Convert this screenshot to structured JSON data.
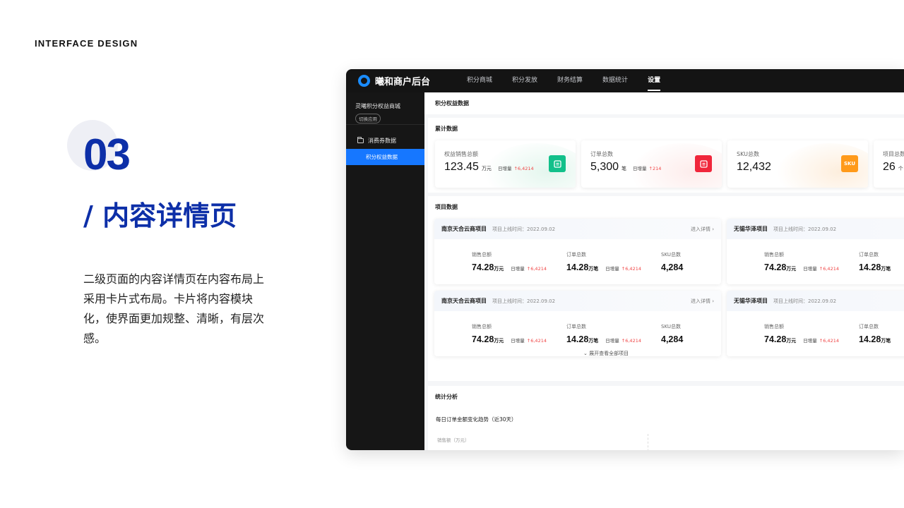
{
  "slide": {
    "brand_label": "INTERFACE DESIGN",
    "number": "03",
    "title": "/ 内容详情页",
    "description": "二级页面的内容详情页在内容布局上采用卡片式布局。卡片将内容模块化，使界面更加规整、清晰，有层次感。"
  },
  "app": {
    "logo_text": "曦和商户后台",
    "nav": [
      {
        "label": "积分商城",
        "active": false
      },
      {
        "label": "积分发放",
        "active": false
      },
      {
        "label": "财务结算",
        "active": false
      },
      {
        "label": "数据统计",
        "active": false
      },
      {
        "label": "设置",
        "active": true
      }
    ],
    "sidebar": {
      "app_name": "灵曦积分权益商城",
      "switch_label": "切换应用",
      "group_label": "消费券数据",
      "active_item": "积分权益数据"
    },
    "page_title": "积分权益数据",
    "cumulative": {
      "title": "累计数据",
      "cards": [
        {
          "label": "权益销售总额",
          "value": "123.45",
          "unit": "万元",
          "inc_label": "日增量",
          "inc": "↑6,4214",
          "icon": "crown-bag-icon",
          "icon_color": "#12c08a",
          "blob_color": "#e4f6ee"
        },
        {
          "label": "订单总数",
          "value": "5,300",
          "unit": "笔",
          "inc_label": "日增量",
          "inc": "↑214",
          "icon": "order-list-icon",
          "icon_color": "#f0263b",
          "blob_color": "#fdeceb"
        },
        {
          "label": "SKU总数",
          "value": "12,432",
          "unit": "",
          "inc_label": "",
          "inc": "",
          "icon": "sku-icon",
          "icon_text": "SKU",
          "icon_color": "#ff9a1a",
          "blob_color": "#fdeedd"
        },
        {
          "label": "项目总数",
          "value": "26",
          "unit": "个",
          "inc_label": "",
          "inc": "",
          "icon": "",
          "icon_color": "",
          "blob_color": "#eef0f5"
        }
      ]
    },
    "projects": {
      "title": "项目数据",
      "date_prefix": "项目上线时间：",
      "link_label": "进入详情 ›",
      "items": [
        {
          "name": "南京天合云商项目",
          "date": "2022.09.02",
          "metrics": [
            {
              "label": "销售总额",
              "value": "74.28",
              "unit": "万元",
              "inc_label": "日增量",
              "inc": "↑6,4214"
            },
            {
              "label": "订单总数",
              "value": "14.28",
              "unit": "万笔",
              "inc_label": "日增量",
              "inc": "↑6,4214"
            },
            {
              "label": "SKU总数",
              "value": "4,284",
              "unit": "",
              "inc_label": "",
              "inc": ""
            }
          ]
        },
        {
          "name": "无锡华泽项目",
          "date": "2022.09.02",
          "metrics": [
            {
              "label": "销售总额",
              "value": "74.28",
              "unit": "万元",
              "inc_label": "日增量",
              "inc": "↑6,4214"
            },
            {
              "label": "订单总数",
              "value": "14.28",
              "unit": "万笔",
              "inc_label": "",
              "inc": ""
            }
          ]
        },
        {
          "name": "南京天合云商项目",
          "date": "2022.09.02",
          "metrics": [
            {
              "label": "销售总额",
              "value": "74.28",
              "unit": "万元",
              "inc_label": "日增量",
              "inc": "↑6,4214"
            },
            {
              "label": "订单总数",
              "value": "14.28",
              "unit": "万笔",
              "inc_label": "日增量",
              "inc": "↑6,4214"
            },
            {
              "label": "SKU总数",
              "value": "4,284",
              "unit": "",
              "inc_label": "",
              "inc": ""
            }
          ]
        },
        {
          "name": "无锡华泽项目",
          "date": "2022.09.02",
          "metrics": [
            {
              "label": "销售总额",
              "value": "74.28",
              "unit": "万元",
              "inc_label": "日增量",
              "inc": "↑6,4214"
            },
            {
              "label": "订单总数",
              "value": "14.28",
              "unit": "万笔",
              "inc_label": "",
              "inc": ""
            }
          ]
        }
      ],
      "expand_label": "⌄  展开查看全部项目"
    },
    "analysis": {
      "title": "统计分析",
      "chart_title": "每日订单金额变化趋势（近30天）",
      "y_label": "销售额（万元）"
    }
  }
}
